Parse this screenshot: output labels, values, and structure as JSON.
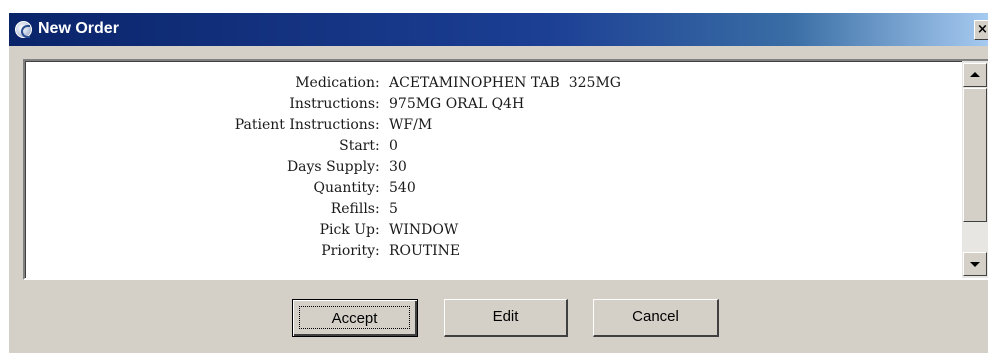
{
  "window": {
    "title": "New Order",
    "close_glyph": "×",
    "title_icon": "app-globe-icon"
  },
  "order_details": [
    {
      "label": "Medication",
      "value": "ACETAMINOPHEN TAB  325MG"
    },
    {
      "label": "Instructions",
      "value": "975MG ORAL Q4H"
    },
    {
      "label": "Patient Instructions",
      "value": "WF/M"
    },
    {
      "label": "Start",
      "value": "0"
    },
    {
      "label": "Days Supply",
      "value": "30"
    },
    {
      "label": "Quantity",
      "value": "540"
    },
    {
      "label": "Refills",
      "value": "5"
    },
    {
      "label": "Pick Up",
      "value": "WINDOW"
    },
    {
      "label": "Priority",
      "value": "ROUTINE"
    }
  ],
  "buttons": {
    "accept": "Accept",
    "edit": "Edit",
    "cancel": "Cancel"
  },
  "colors": {
    "titlebar_start": "#0a246a",
    "titlebar_end": "#a6caf0",
    "dialog_face": "#d4d0c8"
  }
}
